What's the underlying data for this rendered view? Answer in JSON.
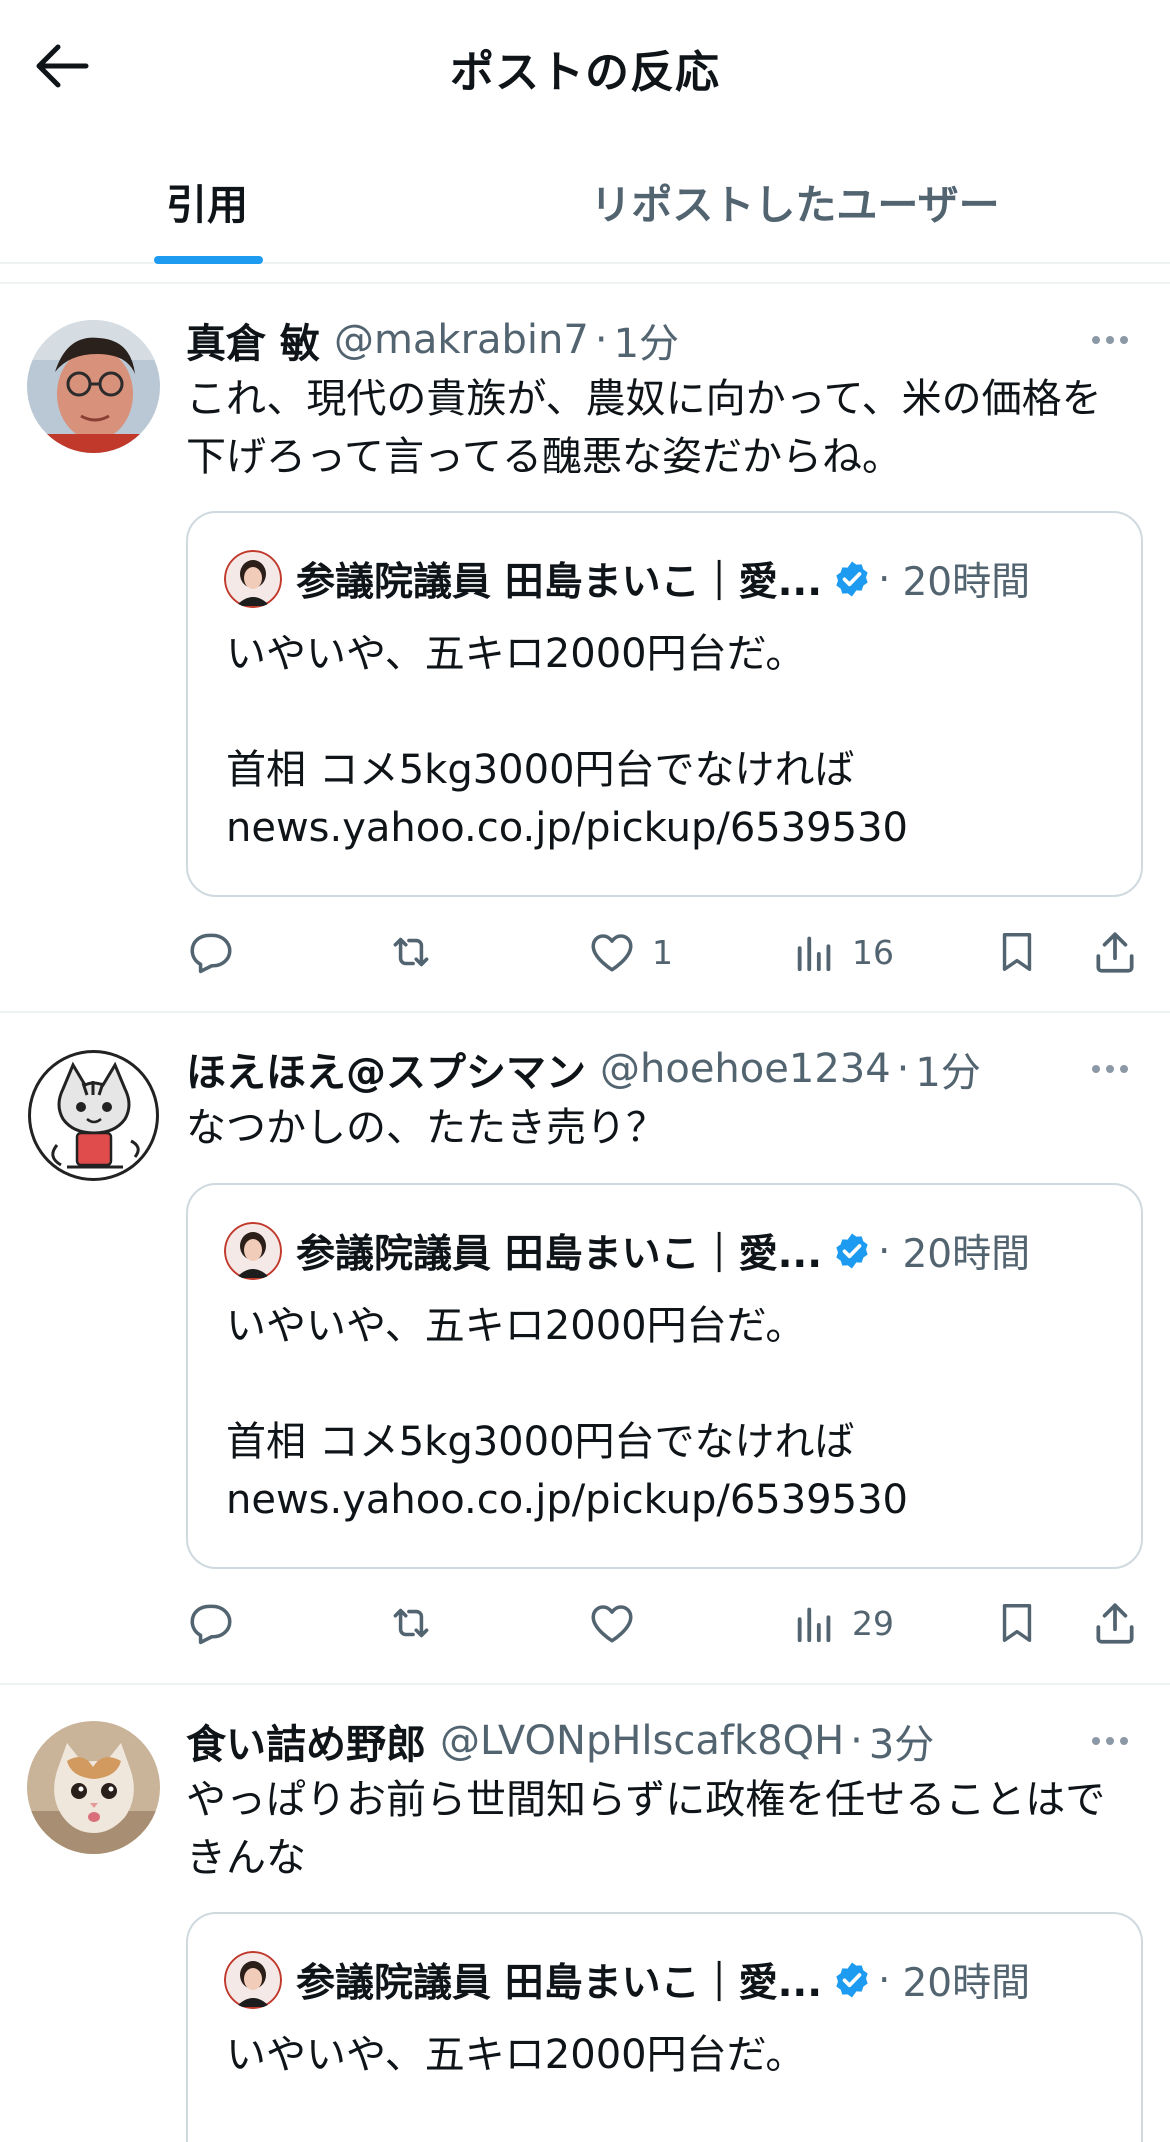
{
  "header": {
    "title": "ポストの反応"
  },
  "tabs": [
    {
      "label": "引用",
      "active": true
    },
    {
      "label": "リポストしたユーザー",
      "active": false
    }
  ],
  "quoted_post": {
    "name": "参議院議員 田島まいこ｜愛...",
    "time": "20時間",
    "verified": true,
    "line1": "いやいや、五キロ2000円台だ。",
    "line2": "首相 コメ5kg3000円台でなければ",
    "line3": "news.yahoo.co.jp/pickup/6539530"
  },
  "posts": [
    {
      "name": "真倉 敏",
      "handle": "@makrabin7",
      "time": "1分",
      "text": "これ、現代の貴族が、農奴に向かって、米の価格を下げろって言ってる醜悪な姿だからね。",
      "likes": "1",
      "views": "16",
      "avatar": "man-photo-avatar"
    },
    {
      "name": "ほえほえ@スプシマン",
      "handle": "@hoehoe1234",
      "time": "1分",
      "text": "なつかしの、たたき売り？",
      "likes": "",
      "views": "29",
      "avatar": "cat-drawing-avatar"
    },
    {
      "name": "食い詰め野郎",
      "handle": "@LVONpHlscafk8QH",
      "time": "3分",
      "text": "やっぱりお前ら世間知らずに政権を任せることはできんな",
      "avatar": "kitten-photo-avatar"
    }
  ],
  "separator": "·",
  "icons": {
    "back": "arrow-left-icon",
    "reply": "reply-icon",
    "repost": "repost-icon",
    "like": "heart-icon",
    "views": "views-icon",
    "bookmark": "bookmark-icon",
    "share": "share-icon",
    "more": "more-icon",
    "verified": "verified-badge-icon"
  },
  "colors": {
    "accent": "#1d9bf0",
    "text": "#0f1419",
    "secondary": "#536471",
    "border": "#cfd9de"
  }
}
